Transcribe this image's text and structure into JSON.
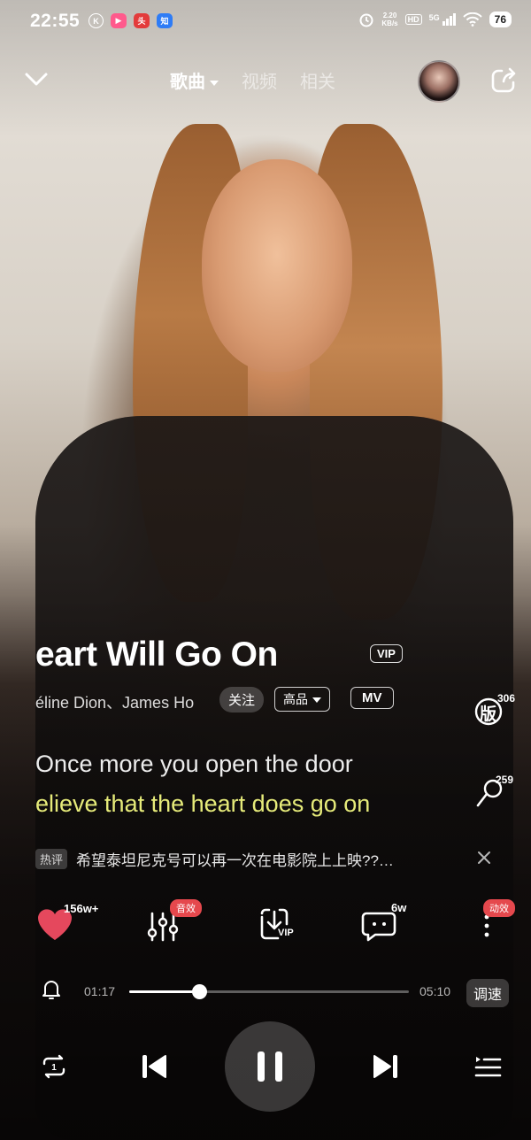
{
  "status_bar": {
    "time": "22:55",
    "net_speed_value": "2.20",
    "net_speed_unit": "KB/s",
    "hd": "HD",
    "signal": "5G",
    "battery": "76"
  },
  "nav": {
    "tabs": [
      {
        "label": "歌曲",
        "active": true
      },
      {
        "label": "视频",
        "active": false
      },
      {
        "label": "相关",
        "active": false
      }
    ]
  },
  "song": {
    "title": "eart Will Go On",
    "vip_tag": "VIP",
    "artist": "éline Dion、James Ho",
    "follow_label": "关注",
    "quality_label": "高品",
    "mv_label": "MV"
  },
  "side_actions": {
    "version_label": "版",
    "version_count": "306",
    "comment_count": "259"
  },
  "lyrics": {
    "previous": "Once more you open the door",
    "current": "elieve that the heart does go on"
  },
  "hot_comment": {
    "tag": "热评",
    "text": "希望泰坦尼克号可以再一次在电影院上上映??…"
  },
  "actions": {
    "like_count": "156w+",
    "sound_effect_badge": "音效",
    "download_vip": "VIP",
    "comment_count": "6w",
    "dynamic_badge": "动效"
  },
  "progress": {
    "current": "01:17",
    "total": "05:10",
    "fraction": 0.25,
    "speed_label": "调速"
  },
  "colors": {
    "lyric_highlight": "#e6eb7a",
    "badge_red": "#e5484d",
    "like_heart": "#e5485d"
  }
}
